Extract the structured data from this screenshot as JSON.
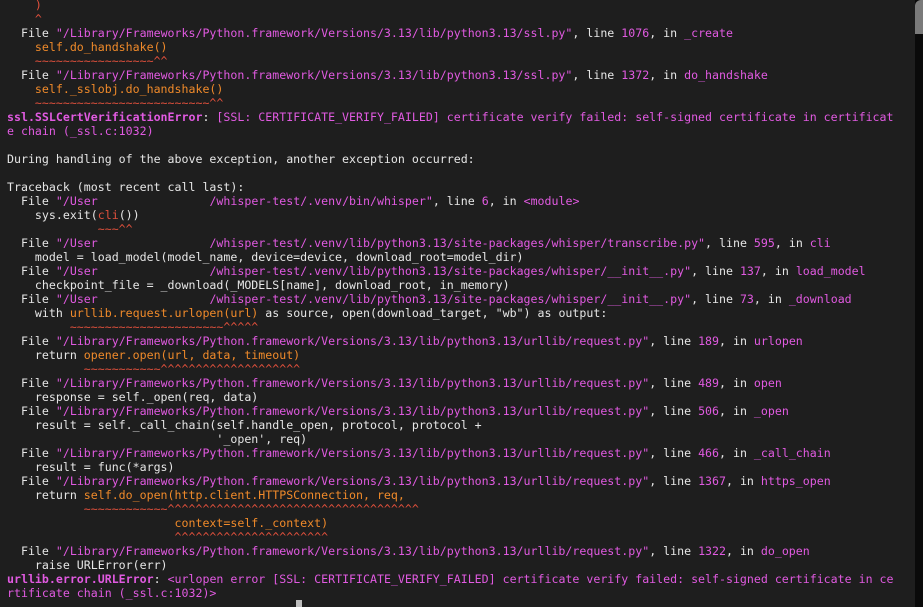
{
  "colors": {
    "background": "#1e1e1e",
    "default_text": "#e6e6e6",
    "magenta": "#e15ae1",
    "orange": "#f08a2a"
  },
  "terminal": {
    "lines": [
      [
        {
          "t": "    )",
          "c": "redd"
        }
      ],
      [
        {
          "t": "    ^",
          "c": "redd"
        }
      ],
      [
        {
          "t": "  File ",
          "c": "white"
        },
        {
          "t": "\"/Library/Frameworks/Python.framework/Versions/3.13/lib/python3.13/ssl.py\"",
          "c": "pink"
        },
        {
          "t": ", line ",
          "c": "white"
        },
        {
          "t": "1076",
          "c": "pink"
        },
        {
          "t": ", in ",
          "c": "white"
        },
        {
          "t": "_create",
          "c": "pink"
        }
      ],
      [
        {
          "t": "    self.do_handshake()",
          "c": "orange"
        }
      ],
      [
        {
          "t": "    ~~~~~~~~~~~~~~~~~^^",
          "c": "redd"
        }
      ],
      [
        {
          "t": "  File ",
          "c": "white"
        },
        {
          "t": "\"/Library/Frameworks/Python.framework/Versions/3.13/lib/python3.13/ssl.py\"",
          "c": "pink"
        },
        {
          "t": ", line ",
          "c": "white"
        },
        {
          "t": "1372",
          "c": "pink"
        },
        {
          "t": ", in ",
          "c": "white"
        },
        {
          "t": "do_handshake",
          "c": "pink"
        }
      ],
      [
        {
          "t": "    self._sslobj.do_handshake()",
          "c": "orange"
        }
      ],
      [
        {
          "t": "    ~~~~~~~~~~~~~~~~~~~~~~~~~^^",
          "c": "redd"
        }
      ],
      [
        {
          "t": "ssl.SSLCertVerificationError",
          "c": "pink bold"
        },
        {
          "t": ": ",
          "c": "white"
        },
        {
          "t": "[SSL: CERTIFICATE_VERIFY_FAILED] certificate verify failed: self-signed certificate in certificat",
          "c": "pink"
        }
      ],
      [
        {
          "t": "e chain (_ssl.c:1032)",
          "c": "pink"
        }
      ],
      [
        {
          "t": "",
          "c": "white"
        }
      ],
      [
        {
          "t": "During handling of the above exception, another exception occurred:",
          "c": "white"
        }
      ],
      [
        {
          "t": "",
          "c": "white"
        }
      ],
      [
        {
          "t": "Traceback (most recent call last):",
          "c": "white"
        }
      ],
      [
        {
          "t": "  File ",
          "c": "white"
        },
        {
          "t": "\"/User",
          "c": "pink"
        },
        {
          "t": "                ",
          "c": "mask"
        },
        {
          "t": "/whisper-test/.venv/bin/whisper\"",
          "c": "pink"
        },
        {
          "t": ", line ",
          "c": "white"
        },
        {
          "t": "6",
          "c": "pink"
        },
        {
          "t": ", in ",
          "c": "white"
        },
        {
          "t": "<module>",
          "c": "pink"
        }
      ],
      [
        {
          "t": "    sys.exit(",
          "c": "white"
        },
        {
          "t": "cli",
          "c": "redd"
        },
        {
          "t": "())",
          "c": "white"
        }
      ],
      [
        {
          "t": "             ~~~^^",
          "c": "redd"
        }
      ],
      [
        {
          "t": "  File ",
          "c": "white"
        },
        {
          "t": "\"/User",
          "c": "pink"
        },
        {
          "t": "                ",
          "c": "mask"
        },
        {
          "t": "/whisper-test/.venv/lib/python3.13/site-packages/whisper/transcribe.py\"",
          "c": "pink"
        },
        {
          "t": ", line ",
          "c": "white"
        },
        {
          "t": "595",
          "c": "pink"
        },
        {
          "t": ", in ",
          "c": "white"
        },
        {
          "t": "cli",
          "c": "pink"
        }
      ],
      [
        {
          "t": "    model = load_model(model_name, device=device, download_root=model_dir)",
          "c": "white"
        }
      ],
      [
        {
          "t": "  File ",
          "c": "white"
        },
        {
          "t": "\"/User",
          "c": "pink"
        },
        {
          "t": "                ",
          "c": "mask"
        },
        {
          "t": "/whisper-test/.venv/lib/python3.13/site-packages/whisper/__init__.py\"",
          "c": "pink"
        },
        {
          "t": ", line ",
          "c": "white"
        },
        {
          "t": "137",
          "c": "pink"
        },
        {
          "t": ", in ",
          "c": "white"
        },
        {
          "t": "load_model",
          "c": "pink"
        }
      ],
      [
        {
          "t": "    checkpoint_file = _download(_MODELS[name], download_root, in_memory)",
          "c": "white"
        }
      ],
      [
        {
          "t": "  File ",
          "c": "white"
        },
        {
          "t": "\"/User",
          "c": "pink"
        },
        {
          "t": "                ",
          "c": "mask"
        },
        {
          "t": "/whisper-test/.venv/lib/python3.13/site-packages/whisper/__init__.py\"",
          "c": "pink"
        },
        {
          "t": ", line ",
          "c": "white"
        },
        {
          "t": "73",
          "c": "pink"
        },
        {
          "t": ", in ",
          "c": "white"
        },
        {
          "t": "_download",
          "c": "pink"
        }
      ],
      [
        {
          "t": "    with ",
          "c": "white"
        },
        {
          "t": "urllib.request.urlopen(url)",
          "c": "orange"
        },
        {
          "t": " as source, open(download_target, \"wb\") as output:",
          "c": "white"
        }
      ],
      [
        {
          "t": "         ~~~~~~~~~~~~~~~~~~~~~~^^^^^",
          "c": "redd"
        }
      ],
      [
        {
          "t": "  File ",
          "c": "white"
        },
        {
          "t": "\"/Library/Frameworks/Python.framework/Versions/3.13/lib/python3.13/urllib/request.py\"",
          "c": "pink"
        },
        {
          "t": ", line ",
          "c": "white"
        },
        {
          "t": "189",
          "c": "pink"
        },
        {
          "t": ", in ",
          "c": "white"
        },
        {
          "t": "urlopen",
          "c": "pink"
        }
      ],
      [
        {
          "t": "    return ",
          "c": "white"
        },
        {
          "t": "opener.open(url, data, timeout)",
          "c": "orange"
        }
      ],
      [
        {
          "t": "           ~~~~~~~~~~~^^^^^^^^^^^^^^^^^^^^",
          "c": "redd"
        }
      ],
      [
        {
          "t": "  File ",
          "c": "white"
        },
        {
          "t": "\"/Library/Frameworks/Python.framework/Versions/3.13/lib/python3.13/urllib/request.py\"",
          "c": "pink"
        },
        {
          "t": ", line ",
          "c": "white"
        },
        {
          "t": "489",
          "c": "pink"
        },
        {
          "t": ", in ",
          "c": "white"
        },
        {
          "t": "open",
          "c": "pink"
        }
      ],
      [
        {
          "t": "    response = self._open(req, data)",
          "c": "white"
        }
      ],
      [
        {
          "t": "  File ",
          "c": "white"
        },
        {
          "t": "\"/Library/Frameworks/Python.framework/Versions/3.13/lib/python3.13/urllib/request.py\"",
          "c": "pink"
        },
        {
          "t": ", line ",
          "c": "white"
        },
        {
          "t": "506",
          "c": "pink"
        },
        {
          "t": ", in ",
          "c": "white"
        },
        {
          "t": "_open",
          "c": "pink"
        }
      ],
      [
        {
          "t": "    result = self._call_chain(self.handle_open, protocol, protocol +",
          "c": "white"
        }
      ],
      [
        {
          "t": "                              '_open', req)",
          "c": "white"
        }
      ],
      [
        {
          "t": "  File ",
          "c": "white"
        },
        {
          "t": "\"/Library/Frameworks/Python.framework/Versions/3.13/lib/python3.13/urllib/request.py\"",
          "c": "pink"
        },
        {
          "t": ", line ",
          "c": "white"
        },
        {
          "t": "466",
          "c": "pink"
        },
        {
          "t": ", in ",
          "c": "white"
        },
        {
          "t": "_call_chain",
          "c": "pink"
        }
      ],
      [
        {
          "t": "    result = func(*args)",
          "c": "white"
        }
      ],
      [
        {
          "t": "  File ",
          "c": "white"
        },
        {
          "t": "\"/Library/Frameworks/Python.framework/Versions/3.13/lib/python3.13/urllib/request.py\"",
          "c": "pink"
        },
        {
          "t": ", line ",
          "c": "white"
        },
        {
          "t": "1367",
          "c": "pink"
        },
        {
          "t": ", in ",
          "c": "white"
        },
        {
          "t": "https_open",
          "c": "pink"
        }
      ],
      [
        {
          "t": "    return ",
          "c": "white"
        },
        {
          "t": "self.do_open(http.client.HTTPSConnection, req,",
          "c": "orange"
        }
      ],
      [
        {
          "t": "           ~~~~~~~~~~~~^^^^^^^^^^^^^^^^^^^^^^^^^^^^^^^^^^^^",
          "c": "redd"
        }
      ],
      [
        {
          "t": "                        context=self._context)",
          "c": "orange"
        }
      ],
      [
        {
          "t": "                        ^^^^^^^^^^^^^^^^^^^^^^",
          "c": "redd"
        }
      ],
      [
        {
          "t": "  File ",
          "c": "white"
        },
        {
          "t": "\"/Library/Frameworks/Python.framework/Versions/3.13/lib/python3.13/urllib/request.py\"",
          "c": "pink"
        },
        {
          "t": ", line ",
          "c": "white"
        },
        {
          "t": "1322",
          "c": "pink"
        },
        {
          "t": ", in ",
          "c": "white"
        },
        {
          "t": "do_open",
          "c": "pink"
        }
      ],
      [
        {
          "t": "    raise URLError(err)",
          "c": "white"
        }
      ],
      [
        {
          "t": "urllib.error.URLError",
          "c": "pink bold"
        },
        {
          "t": ": ",
          "c": "white"
        },
        {
          "t": "<urlopen error [SSL: CERTIFICATE_VERIFY_FAILED] certificate verify failed: self-signed certificate in ce",
          "c": "pink"
        }
      ],
      [
        {
          "t": "rtificate chain (_ssl.c:1032)>",
          "c": "pink"
        }
      ]
    ]
  }
}
